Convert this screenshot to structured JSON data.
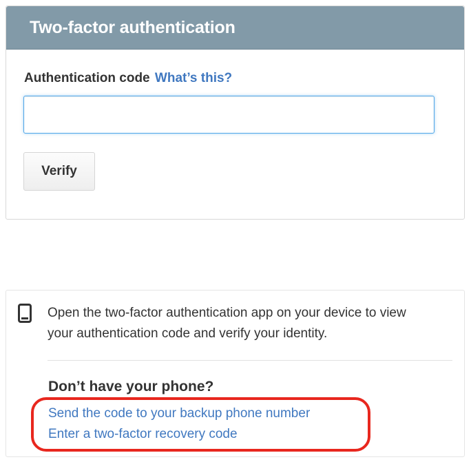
{
  "auth_box": {
    "title": "Two-factor authentication",
    "code_label": "Authentication code",
    "help_link": "What’s this?",
    "code_input": {
      "value": "",
      "placeholder": ""
    },
    "verify_label": "Verify"
  },
  "help_box": {
    "icon": "mobile-phone-icon",
    "description": "Open the two-factor authentication app on your device to view your authentication code and verify your identity.",
    "alt_heading": "Don’t have your phone?",
    "links": [
      "Send the code to your backup phone number",
      "Enter a two-factor recovery code"
    ]
  },
  "annotation": {
    "color": "#e8271e"
  },
  "colors": {
    "header_bg": "#829aa8",
    "link": "#4078c0",
    "input_focus": "#51a7e8"
  }
}
